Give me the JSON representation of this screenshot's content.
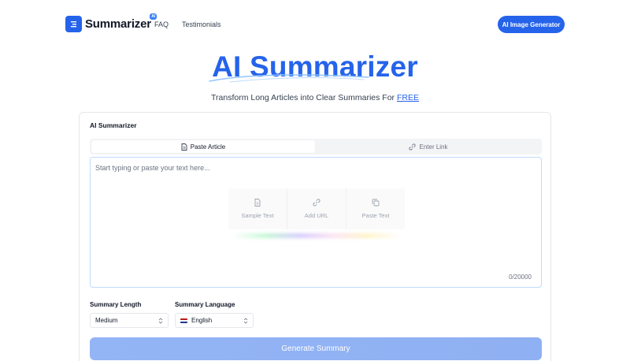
{
  "header": {
    "logo_text": "Summarizer",
    "logo_badge": "AI",
    "nav": {
      "faq": "FAQ",
      "testimonials": "Testimonials"
    },
    "cta_label": "AI Image Generator"
  },
  "hero": {
    "title": "AI Summarizer",
    "subtitle": "Transform Long Articles into Clear Summaries For ",
    "subtitle_highlight": "FREE"
  },
  "card": {
    "title": "AI Summarizer",
    "tabs": [
      {
        "label": "Paste Article",
        "icon": "document-icon",
        "active": true
      },
      {
        "label": "Enter Link",
        "icon": "link-icon",
        "active": false
      }
    ],
    "input": {
      "placeholder": "Start typing or paste your text here...",
      "value": ""
    },
    "actions": [
      {
        "label": "Sample Text",
        "icon": "document-icon"
      },
      {
        "label": "Add URL",
        "icon": "link-icon"
      },
      {
        "label": "Paste Text",
        "icon": "copy-icon"
      }
    ],
    "char_count": "0/20000",
    "summary_length": {
      "label": "Summary Length",
      "value": "Medium"
    },
    "summary_language": {
      "label": "Summary Language",
      "value": "English"
    },
    "generate_label": "Generate Summary"
  },
  "colors": {
    "accent": "#2563eb",
    "button_disabled": "#93b4f5"
  }
}
